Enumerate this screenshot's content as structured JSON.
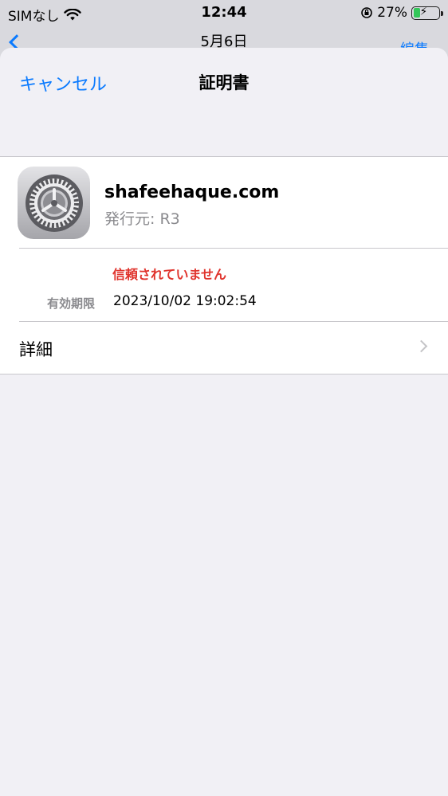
{
  "status_bar": {
    "carrier": "SIMなし",
    "time": "12:44",
    "battery_percent": "27%"
  },
  "underlying": {
    "date": "5月6日",
    "edit": "編集"
  },
  "nav": {
    "cancel_label": "キャンセル",
    "title": "証明書"
  },
  "certificate": {
    "name": "shafeehaque.com",
    "issuer": "発行元: R3",
    "trust_status": "信頼されていません",
    "expires_label": "有効期限",
    "expires_value": "2023/10/02 19:02:54",
    "detail_label": "詳細"
  },
  "colors": {
    "accent": "#0a7aff",
    "warning": "#e0332c",
    "battery": "#34c759"
  },
  "icons": {
    "app": "settings-gear-icon",
    "detail": "chevron-right-icon"
  }
}
